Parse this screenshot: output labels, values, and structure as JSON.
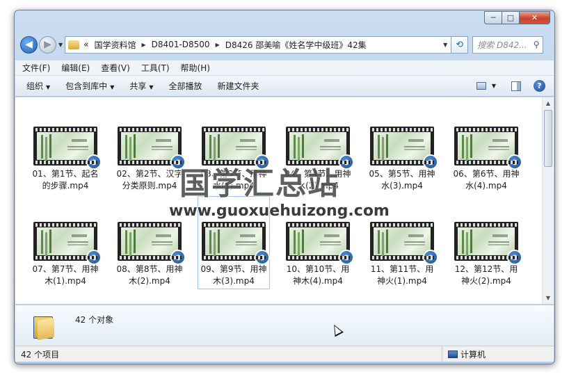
{
  "window": {
    "minimize": "─",
    "maximize": "□",
    "close": "✕"
  },
  "nav": {
    "back": "◀",
    "forward": "▶",
    "breadcrumb": {
      "overflow": "«",
      "seg1": "国学资料馆",
      "seg2": "D8401-D8500",
      "seg3": "D8426 邵美喻《姓名学中级班》42集"
    },
    "search_placeholder": "搜索 D842..."
  },
  "menu": {
    "file": "文件(F)",
    "edit": "编辑(E)",
    "view": "查看(V)",
    "tools": "工具(T)",
    "help": "帮助(H)"
  },
  "toolbar": {
    "organize": "组织",
    "include": "包含到库中",
    "share": "共享",
    "play_all": "全部播放",
    "new_folder": "新建文件夹",
    "help": "?"
  },
  "files": [
    {
      "name": "01、第1节、起名的步骤.mp4"
    },
    {
      "name": "02、第2节、汉字分类原则.mp4"
    },
    {
      "name": "03、第3节、用神水(1).mp4"
    },
    {
      "name": "04、第4节、用神水(2).mp4"
    },
    {
      "name": "05、第5节、用神水(3).mp4"
    },
    {
      "name": "06、第6节、用神水(4).mp4"
    },
    {
      "name": "07、第7节、用神木(1).mp4"
    },
    {
      "name": "08、第8节、用神木(2).mp4"
    },
    {
      "name": "09、第9节、用神木(3).mp4"
    },
    {
      "name": "10、第10节、用神木(4).mp4"
    },
    {
      "name": "11、第11节、用神火(1).mp4"
    },
    {
      "name": "12、第12节、用神火(2).mp4"
    }
  ],
  "details": {
    "count": "42 个对象"
  },
  "status": {
    "items": "42 个项目",
    "computer": "计算机"
  },
  "watermark": {
    "line1": "国学汇总站",
    "line2": "www.guoxuehuizong.com"
  }
}
